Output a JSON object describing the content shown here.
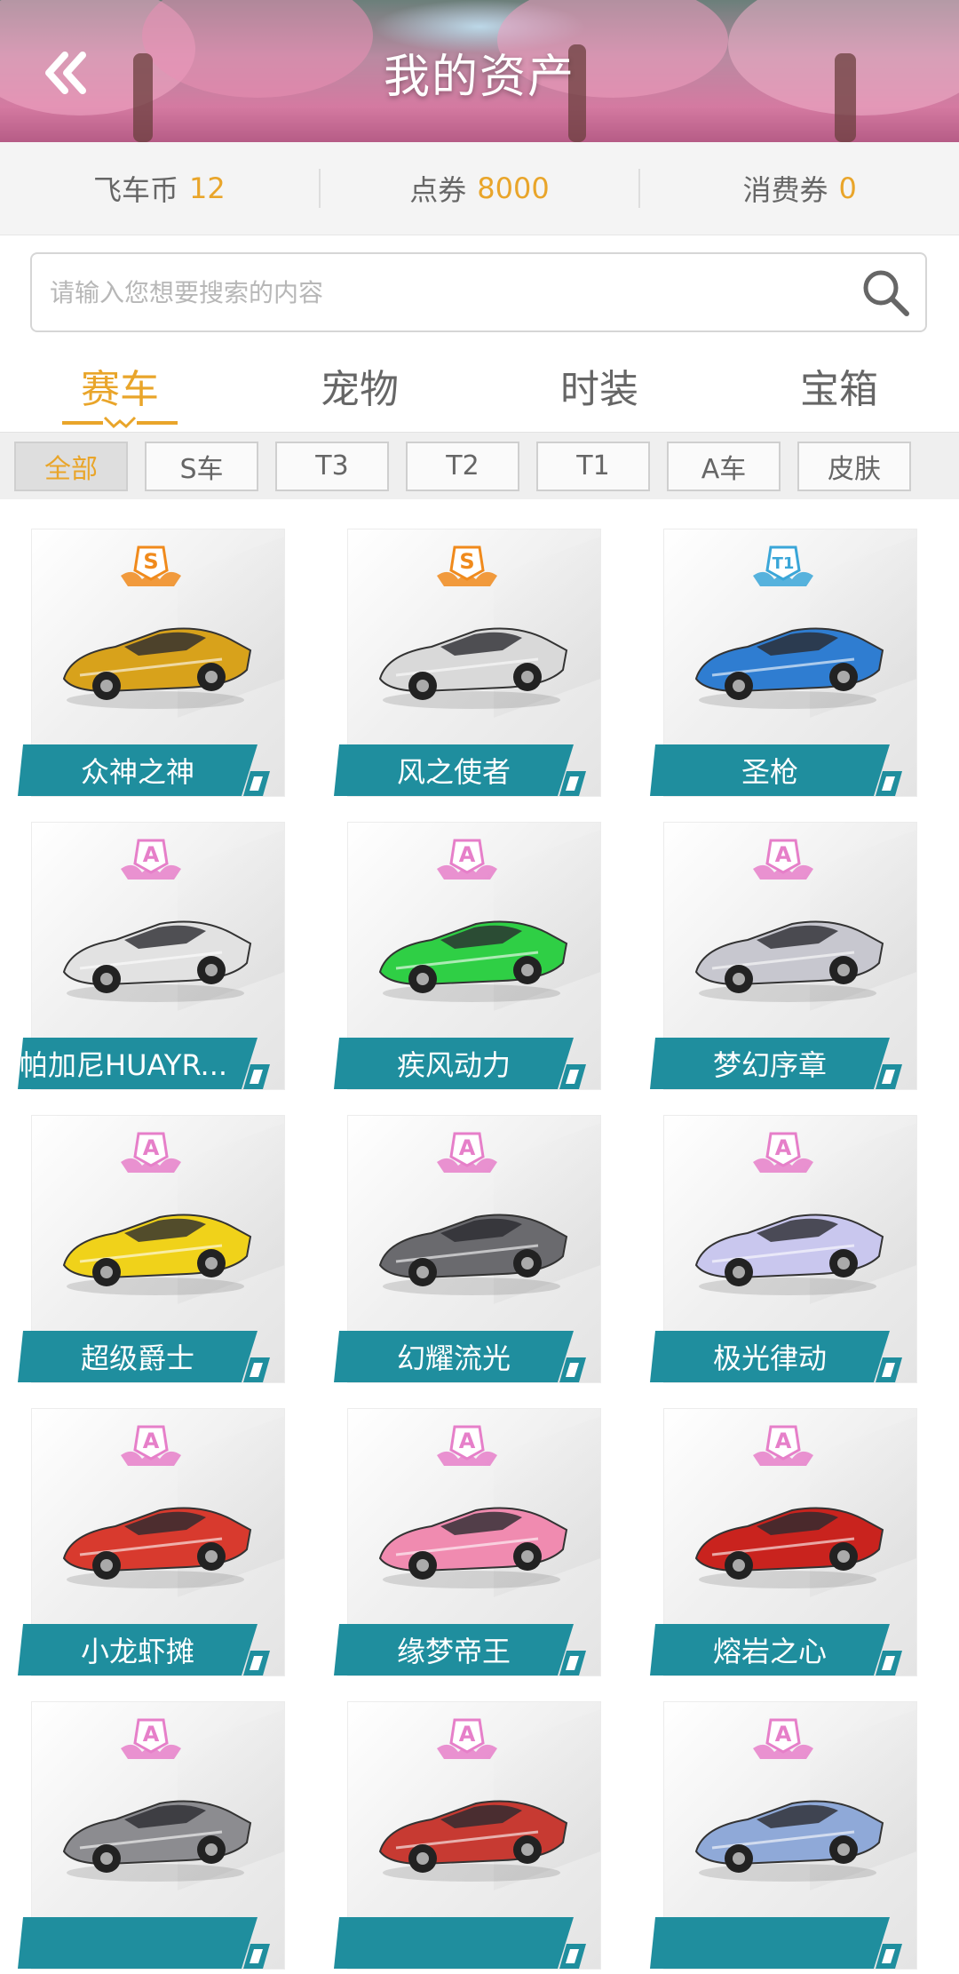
{
  "header": {
    "title": "我的资产",
    "back_icon": "double-chevron-left-icon"
  },
  "currency": [
    {
      "label": "飞车币",
      "value": "12"
    },
    {
      "label": "点券",
      "value": "8000"
    },
    {
      "label": "消费券",
      "value": "0"
    }
  ],
  "search": {
    "placeholder": "请输入您想要搜索的内容",
    "icon": "search-icon"
  },
  "tabs": [
    {
      "label": "赛车",
      "active": true
    },
    {
      "label": "宠物",
      "active": false
    },
    {
      "label": "时装",
      "active": false
    },
    {
      "label": "宝箱",
      "active": false
    }
  ],
  "filters": [
    {
      "label": "全部",
      "active": true
    },
    {
      "label": "S车",
      "active": false
    },
    {
      "label": "T3",
      "active": false
    },
    {
      "label": "T2",
      "active": false
    },
    {
      "label": "T1",
      "active": false
    },
    {
      "label": "A车",
      "active": false
    },
    {
      "label": "皮肤",
      "active": false
    }
  ],
  "colors": {
    "accent": "#e9a52a",
    "banner": "#1f8e9e",
    "grade_s": "#f08a1c",
    "grade_t": "#3aa6d8",
    "grade_a": "#e67fc9"
  },
  "cars": [
    {
      "name": "众神之神",
      "grade": "S",
      "color": "#d8a21b"
    },
    {
      "name": "风之使者",
      "grade": "S",
      "color": "#d9d9d9"
    },
    {
      "name": "圣枪",
      "grade": "T1",
      "color": "#2f7dd1"
    },
    {
      "name": "帕加尼HUAYR...",
      "grade": "A",
      "color": "#e2e2e2"
    },
    {
      "name": "疾风动力",
      "grade": "A",
      "color": "#2fcf45"
    },
    {
      "name": "梦幻序章",
      "grade": "A",
      "color": "#c7c7cf"
    },
    {
      "name": "超级爵士",
      "grade": "A",
      "color": "#f0d21a"
    },
    {
      "name": "幻耀流光",
      "grade": "A",
      "color": "#6a6a6e"
    },
    {
      "name": "极光律动",
      "grade": "A",
      "color": "#c9c7ee"
    },
    {
      "name": "小龙虾摊",
      "grade": "A",
      "color": "#d83a2e"
    },
    {
      "name": "缘梦帝王",
      "grade": "A",
      "color": "#f08bb0"
    },
    {
      "name": "熔岩之心",
      "grade": "A",
      "color": "#c9231e"
    },
    {
      "name": "",
      "grade": "A",
      "color": "#8c8c90"
    },
    {
      "name": "",
      "grade": "A",
      "color": "#c73a32"
    },
    {
      "name": "",
      "grade": "A",
      "color": "#8fa9d8"
    }
  ]
}
